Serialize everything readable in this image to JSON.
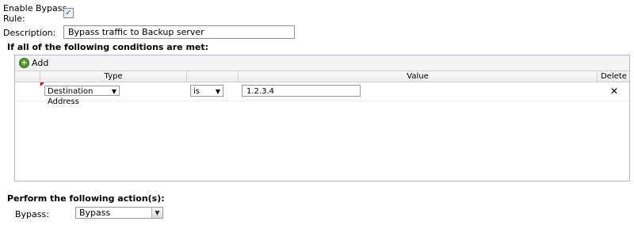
{
  "form": {
    "enable_label_line1": "Enable Bypass",
    "enable_label_line2": "Rule:",
    "enable_checked_mark": "✓",
    "description_label": "Description:",
    "description_value": "Bypass traffic to Backup server"
  },
  "conditions": {
    "title": "If all of the following conditions are met:",
    "add_label": "Add",
    "columns": {
      "type": "Type",
      "operator": "",
      "value": "Value",
      "delete": "Delete"
    },
    "rows": [
      {
        "type": "Destination Address",
        "operator": "is",
        "value": "1.2.3.4",
        "delete_glyph": "✕"
      }
    ]
  },
  "actions": {
    "title": "Perform the following action(s):",
    "bypass_label": "Bypass:",
    "bypass_value": "Bypass"
  },
  "colors": {
    "grid_border": "#b5b8c8",
    "dirty_marker": "#dd0000",
    "add_icon": "#4e9a2a"
  }
}
